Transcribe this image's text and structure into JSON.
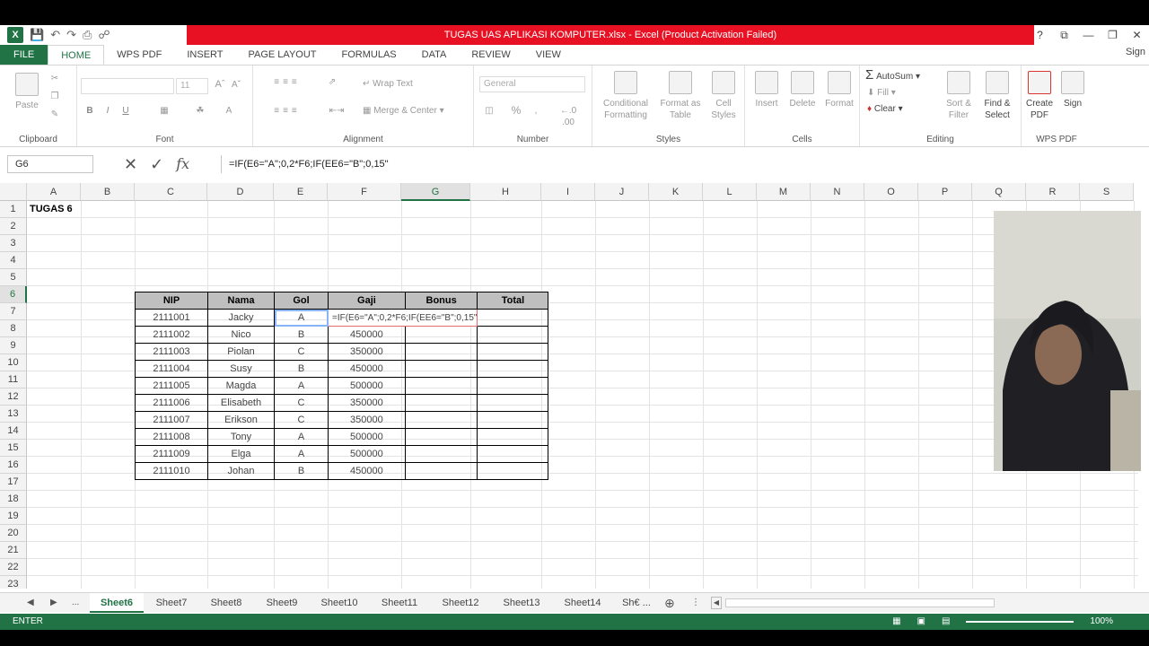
{
  "window": {
    "title": "TUGAS UAS APLIKASI KOMPUTER.xlsx - Excel (Product Activation Failed)",
    "controls": [
      "?",
      "⧉",
      "—",
      "❐",
      "✕"
    ]
  },
  "ribbon_tabs": [
    "FILE",
    "HOME",
    "WPS PDF",
    "INSERT",
    "PAGE LAYOUT",
    "FORMULAS",
    "DATA",
    "REVIEW",
    "VIEW"
  ],
  "signin": "Sign",
  "ribbon": {
    "clipboard": {
      "paste": "Paste",
      "label": "Clipboard"
    },
    "font": {
      "size": "11",
      "label": "Font",
      "bold": "B",
      "italic": "I",
      "underline": "U"
    },
    "alignment": {
      "wrap_text": "Wrap Text",
      "merge_center": "Merge & Center",
      "label": "Alignment"
    },
    "number": {
      "format": "General",
      "label": "Number",
      "percent": "%"
    },
    "styles": {
      "conditional": "Conditional",
      "formatting": "Formatting",
      "format_as": "Format as",
      "table": "Table",
      "cell": "Cell",
      "cell_styles": "Styles",
      "label": "Styles"
    },
    "cells": {
      "insert": "Insert",
      "delete": "Delete",
      "format": "Format",
      "label": "Cells"
    },
    "editing": {
      "autosum": "AutoSum",
      "fill": "Fill",
      "clear": "Clear",
      "sort": "Sort &",
      "filter": "Filter",
      "find": "Find &",
      "select": "Select",
      "label": "Editing"
    },
    "wps": {
      "create": "Create",
      "pdf": "PDF",
      "sign": "Sign",
      "label": "WPS PDF"
    }
  },
  "formula_bar": {
    "name_box": "G6",
    "fx": "fx",
    "formula": "=IF(E6=\"A\";0,2*F6;IF(EE6=\"B\";0,15\""
  },
  "columns": [
    "A",
    "B",
    "C",
    "D",
    "E",
    "F",
    "G",
    "H",
    "I",
    "J",
    "K",
    "L",
    "M",
    "N",
    "O",
    "P",
    "Q",
    "R",
    "S"
  ],
  "rows": [
    "1",
    "2",
    "3",
    "4",
    "5",
    "6",
    "7",
    "8",
    "9",
    "10",
    "11",
    "12",
    "13",
    "14",
    "15",
    "16",
    "17",
    "18",
    "19",
    "20",
    "21",
    "22",
    "23"
  ],
  "sheet_title": "TUGAS 6",
  "table": {
    "headers": [
      "NIP",
      "Nama",
      "Gol",
      "Gaji",
      "Bonus",
      "Total"
    ],
    "rows": [
      [
        "2111001",
        "Jacky",
        "A",
        "=IF(E6=\"A\";0,2*F6;IF(EE6=\"B\";0,15\""
      ],
      [
        "2111002",
        "Nico",
        "B",
        "450000"
      ],
      [
        "2111003",
        "Piolan",
        "C",
        "350000"
      ],
      [
        "2111004",
        "Susy",
        "B",
        "450000"
      ],
      [
        "2111005",
        "Magda",
        "A",
        "500000"
      ],
      [
        "2111006",
        "Elisabeth",
        "C",
        "350000"
      ],
      [
        "2111007",
        "Erikson",
        "C",
        "350000"
      ],
      [
        "2111008",
        "Tony",
        "A",
        "500000"
      ],
      [
        "2111009",
        "Elga",
        "A",
        "500000"
      ],
      [
        "2111010",
        "Johan",
        "B",
        "450000"
      ]
    ]
  },
  "sheets": [
    "Sheet6",
    "Sheet7",
    "Sheet8",
    "Sheet9",
    "Sheet10",
    "Sheet11",
    "Sheet12",
    "Sheet13",
    "Sheet14",
    "Sh€ ..."
  ],
  "sheet_nav": {
    "ellipsis": "..."
  },
  "status": {
    "mode": "ENTER",
    "zoom": "100%"
  }
}
